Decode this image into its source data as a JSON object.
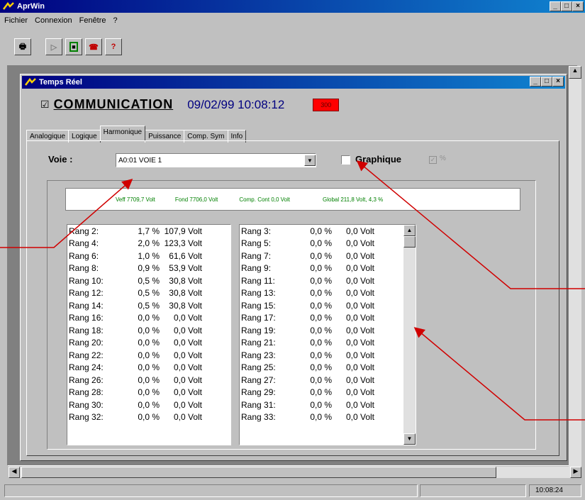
{
  "app": {
    "title": "AprWin",
    "menu": [
      "Fichier",
      "Connexion",
      "Fenêtre",
      "?"
    ]
  },
  "toolbar": [
    {
      "name": "print-icon",
      "glyph": "🖶"
    },
    {
      "name": "play-icon",
      "glyph": "▷"
    },
    {
      "name": "stop-icon",
      "glyph": "■"
    },
    {
      "name": "phone-icon",
      "glyph": "☎"
    },
    {
      "name": "help-icon",
      "glyph": "?"
    }
  ],
  "window": {
    "title": "Temps Réel"
  },
  "comm": {
    "checkbox": "☑",
    "label": "COMMUNICATION",
    "datetime": "09/02/99 10:08:12",
    "indicator": "300"
  },
  "tabs": [
    "Analogique",
    "Logique",
    "Harmonique",
    "Puissance",
    "Comp. Sym",
    "Info"
  ],
  "active_tab": "Harmonique",
  "voie": {
    "label": "Voie :",
    "value": "A0:01 VOIE 1"
  },
  "graphique": {
    "label": "Graphique",
    "percent": "%"
  },
  "summary": {
    "veff": "Veff 7709,7 Volt",
    "fond": "Fond 7706,0 Volt",
    "comp": "Comp. Cont 0,0 Volt",
    "global": "Global 211,8 Volt, 4,3 %"
  },
  "left_list": [
    [
      "Rang 2:",
      "1,7 %",
      "107,9 Volt"
    ],
    [
      "Rang 4:",
      "2,0 %",
      "123,3 Volt"
    ],
    [
      "Rang 6:",
      "1,0 %",
      "61,6 Volt"
    ],
    [
      "Rang 8:",
      "0,9 %",
      "53,9 Volt"
    ],
    [
      "Rang 10:",
      "0,5 %",
      "30,8 Volt"
    ],
    [
      "Rang 12:",
      "0,5 %",
      "30,8 Volt"
    ],
    [
      "Rang 14:",
      "0,5 %",
      "30,8 Volt"
    ],
    [
      "Rang 16:",
      "0,0 %",
      "0,0 Volt"
    ],
    [
      "Rang 18:",
      "0,0 %",
      "0,0 Volt"
    ],
    [
      "Rang 20:",
      "0,0 %",
      "0,0 Volt"
    ],
    [
      "Rang 22:",
      "0,0 %",
      "0,0 Volt"
    ],
    [
      "Rang 24:",
      "0,0 %",
      "0,0 Volt"
    ],
    [
      "Rang 26:",
      "0,0 %",
      "0,0 Volt"
    ],
    [
      "Rang 28:",
      "0,0 %",
      "0,0 Volt"
    ],
    [
      "Rang 30:",
      "0,0 %",
      "0,0 Volt"
    ],
    [
      "Rang 32:",
      "0,0 %",
      "0,0 Volt"
    ]
  ],
  "right_list": [
    [
      "Rang 3:",
      "0,0 %",
      "0,0 Volt"
    ],
    [
      "Rang 5:",
      "0,0 %",
      "0,0 Volt"
    ],
    [
      "Rang 7:",
      "0,0 %",
      "0,0 Volt"
    ],
    [
      "Rang 9:",
      "0,0 %",
      "0,0 Volt"
    ],
    [
      "Rang 11:",
      "0,0 %",
      "0,0 Volt"
    ],
    [
      "Rang 13:",
      "0,0 %",
      "0,0 Volt"
    ],
    [
      "Rang 15:",
      "0,0 %",
      "0,0 Volt"
    ],
    [
      "Rang 17:",
      "0,0 %",
      "0,0 Volt"
    ],
    [
      "Rang 19:",
      "0,0 %",
      "0,0 Volt"
    ],
    [
      "Rang 21:",
      "0,0 %",
      "0,0 Volt"
    ],
    [
      "Rang 23:",
      "0,0 %",
      "0,0 Volt"
    ],
    [
      "Rang 25:",
      "0,0 %",
      "0,0 Volt"
    ],
    [
      "Rang 27:",
      "0,0 %",
      "0,0 Volt"
    ],
    [
      "Rang 29:",
      "0,0 %",
      "0,0 Volt"
    ],
    [
      "Rang 31:",
      "0,0 %",
      "0,0 Volt"
    ],
    [
      "Rang 33:",
      "0,0 %",
      "0,0 Volt"
    ]
  ],
  "status": {
    "time": "10:08:24"
  },
  "colors": {
    "title_start": "#000080",
    "title_end": "#1084d0",
    "summary_green": "#008000",
    "summary_blue": "#0000c0",
    "comm_blue": "#000080",
    "indicator_red": "#ff0000",
    "annotation_red": "#d00000"
  }
}
